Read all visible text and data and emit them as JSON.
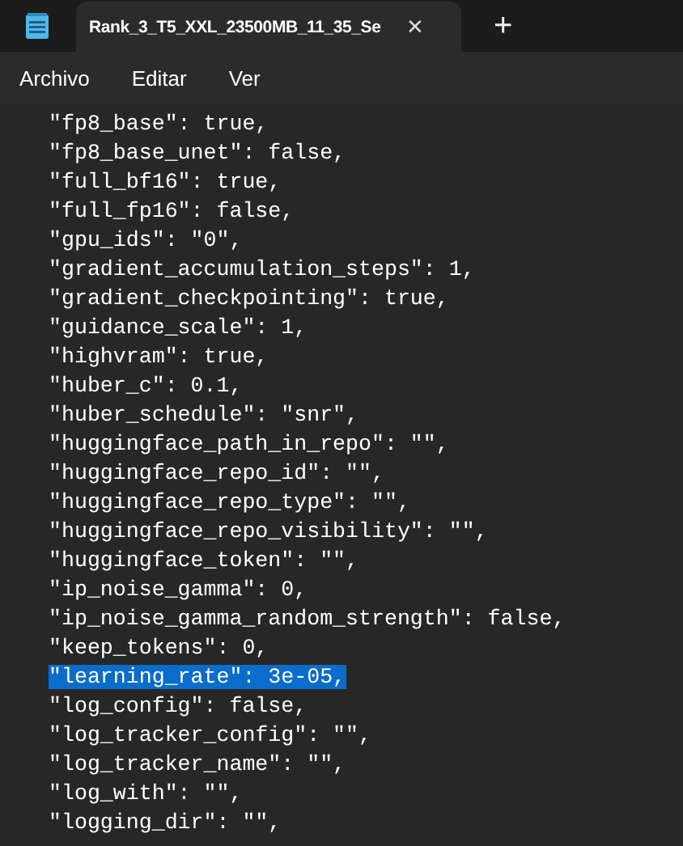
{
  "window": {
    "tab_title": "Rank_3_T5_XXL_23500MB_11_35_Se",
    "close": "✕",
    "new_tab": "+"
  },
  "menu": [
    "Archivo",
    "Editar",
    "Ver"
  ],
  "editor": {
    "lines": [
      {
        "text": "\"fp8_base\": true,",
        "selected": false
      },
      {
        "text": "\"fp8_base_unet\": false,",
        "selected": false
      },
      {
        "text": "\"full_bf16\": true,",
        "selected": false
      },
      {
        "text": "\"full_fp16\": false,",
        "selected": false
      },
      {
        "text": "\"gpu_ids\": \"0\",",
        "selected": false
      },
      {
        "text": "\"gradient_accumulation_steps\": 1,",
        "selected": false
      },
      {
        "text": "\"gradient_checkpointing\": true,",
        "selected": false
      },
      {
        "text": "\"guidance_scale\": 1,",
        "selected": false
      },
      {
        "text": "\"highvram\": true,",
        "selected": false
      },
      {
        "text": "\"huber_c\": 0.1,",
        "selected": false
      },
      {
        "text": "\"huber_schedule\": \"snr\",",
        "selected": false
      },
      {
        "text": "\"huggingface_path_in_repo\": \"\",",
        "selected": false
      },
      {
        "text": "\"huggingface_repo_id\": \"\",",
        "selected": false
      },
      {
        "text": "\"huggingface_repo_type\": \"\",",
        "selected": false
      },
      {
        "text": "\"huggingface_repo_visibility\": \"\",",
        "selected": false
      },
      {
        "text": "\"huggingface_token\": \"\",",
        "selected": false
      },
      {
        "text": "\"ip_noise_gamma\": 0,",
        "selected": false
      },
      {
        "text": "\"ip_noise_gamma_random_strength\": false,",
        "selected": false
      },
      {
        "text": "\"keep_tokens\": 0,",
        "selected": false
      },
      {
        "text": "\"learning_rate\": 3e-05,",
        "selected": true
      },
      {
        "text": "\"log_config\": false,",
        "selected": false
      },
      {
        "text": "\"log_tracker_config\": \"\",",
        "selected": false
      },
      {
        "text": "\"log_tracker_name\": \"\",",
        "selected": false
      },
      {
        "text": "\"log_with\": \"\",",
        "selected": false
      },
      {
        "text": "\"logging_dir\": \"\",",
        "selected": false
      }
    ]
  }
}
